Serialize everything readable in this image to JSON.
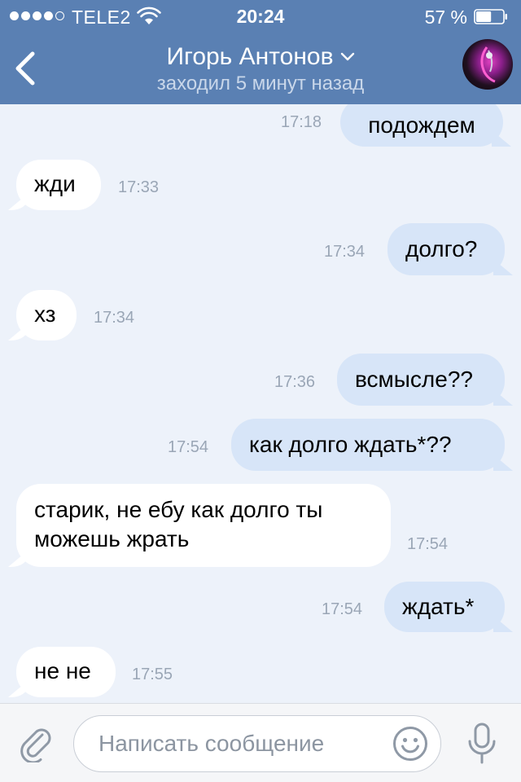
{
  "status_bar": {
    "carrier": "TELE2",
    "time": "20:24",
    "battery_percent": "57 %",
    "battery_level": 0.57,
    "signal_bars_filled": 4,
    "signal_bars_total": 5
  },
  "header": {
    "contact_name": "Игорь Антонов",
    "contact_status": "заходил 5 минут назад",
    "accent_color": "#5a80b3"
  },
  "messages": [
    {
      "direction": "out",
      "text": "подождем",
      "time": "17:18"
    },
    {
      "direction": "in",
      "text": "жди",
      "time": "17:33"
    },
    {
      "direction": "out",
      "text": "долго?",
      "time": "17:34"
    },
    {
      "direction": "in",
      "text": "хз",
      "time": "17:34"
    },
    {
      "direction": "out",
      "text": "всмысле??",
      "time": "17:36"
    },
    {
      "direction": "out",
      "text": "как долго ждать*??",
      "time": "17:54"
    },
    {
      "direction": "in",
      "text_line1": "старик, не ебу как долго ты",
      "text_line2": "можешь жрать",
      "time": "17:54"
    },
    {
      "direction": "out",
      "text": "ждать*",
      "time": "17:54"
    },
    {
      "direction": "in",
      "text": "не не",
      "time": "17:55"
    }
  ],
  "input": {
    "placeholder": "Написать сообщение"
  },
  "icons": {
    "back": "back-chevron-icon",
    "attach": "paperclip-icon",
    "emoji": "smiley-icon",
    "mic": "microphone-icon"
  }
}
